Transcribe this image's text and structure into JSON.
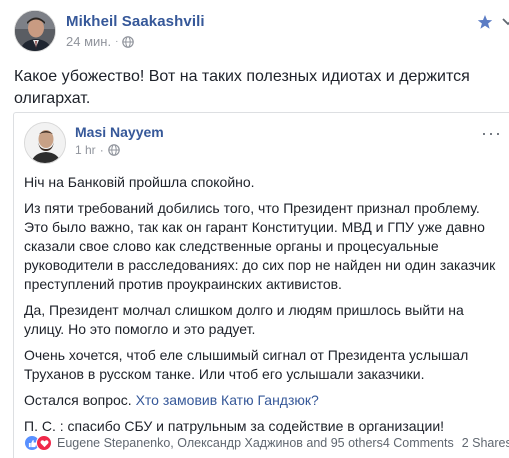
{
  "outer_post": {
    "author": "Mikheil Saakashvili",
    "time": "24 мин.",
    "separator": "·",
    "text": "Какое убожество! Вот на таких полезных идиотах и держится олигархат.",
    "icons": {
      "star": "star-icon",
      "menu": "chevron-down-icon",
      "privacy": "globe-icon"
    },
    "accent_color": "#365899"
  },
  "shared_post": {
    "author": "Masi Nayyem",
    "time": "1 hr",
    "separator": "·",
    "more": "···",
    "paragraphs": [
      "Ніч на Банковій пройшла спокойно.",
      "Из пяти требований добились того, что Президент признал проблему. Это было важно, так как он гарант Конституции. МВД и ГПУ уже давно сказали свое слово как следственные органы и процесуальные руководители в расследованиях: до сих пор не найден ни один заказчик преступлений против проукраинских активистов.",
      "Да, Президент молчал слишком долго и людям пришлось выйти на улицу. Но это помогло и это радует.",
      "Очень хочется, чтоб еле слышимый сигнал от Президента услышал Труханов в русском танке. Или чтоб его услышали заказчики."
    ],
    "question_prefix": "Остался вопрос.",
    "question_link": "Хто замовив Катю Гандзюк?",
    "postscript": "П. С. : спасибо СБУ и патрульным за содействие в организации!",
    "reactions_text": "Eugene Stepanenko, Олександр Хаджинов and 95 others",
    "comments": "4 Comments",
    "shares": "2 Shares",
    "reaction_colors": {
      "like": "#5890ff",
      "love": "#f0284a"
    }
  }
}
